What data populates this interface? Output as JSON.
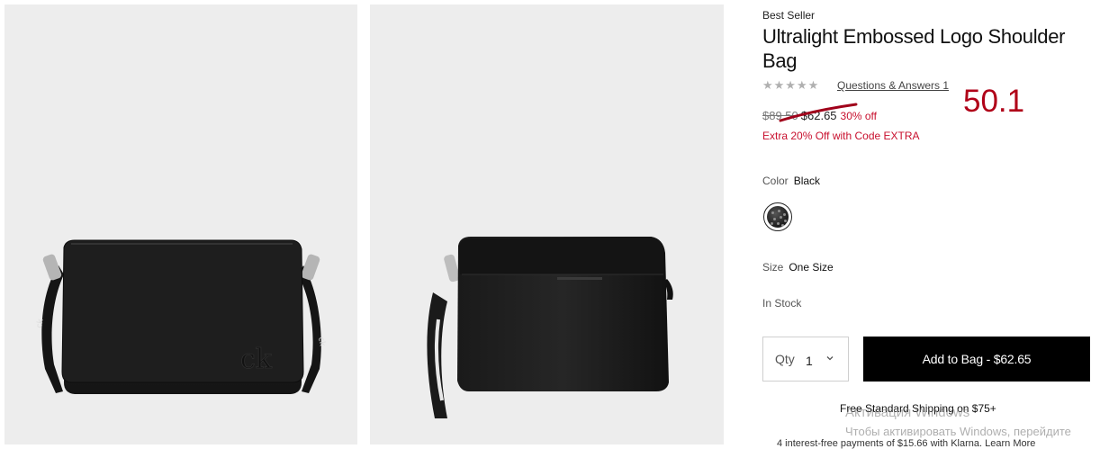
{
  "colors": {
    "accent_red": "#c8102e",
    "annotation_red": "#b00018",
    "button_bg": "#000000",
    "photo_bg": "#ededed"
  },
  "gallery": {
    "images": [
      {
        "name": "bag-front-view",
        "alt": ""
      },
      {
        "name": "bag-back-view",
        "alt": ""
      }
    ]
  },
  "product": {
    "badge": "Best Seller",
    "title": "Ultralight Embossed Logo Shoulder Bag",
    "rating_stars": "★★★★★",
    "qa_link": "Questions & Answers 1",
    "original_price": "$89.50",
    "sale_price": "$62.65",
    "percent_off": "30% off",
    "promo": "Extra 20% Off with Code EXTRA",
    "annotation": "50.1",
    "color_label": "Color",
    "color_value": "Black",
    "size_label": "Size",
    "size_value": "One Size",
    "stock": "In Stock",
    "qty_label": "Qty",
    "qty_value": "1",
    "add_button": "Add to Bag - $62.65",
    "shipping": "Free Standard Shipping on $75+",
    "klarna_text": "4 interest-free payments of $15.66 with Klarna. Learn More"
  },
  "windows_overlay": {
    "line1": "Активация Windows",
    "line2": "Чтобы активировать Windows, перейдите"
  }
}
